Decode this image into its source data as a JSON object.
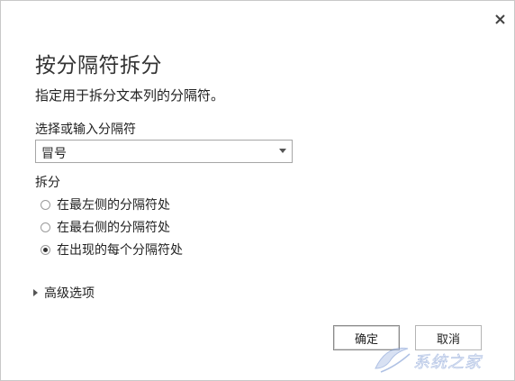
{
  "dialog": {
    "title": "按分隔符拆分",
    "description": "指定用于拆分文本列的分隔符。",
    "close_icon": "close-icon",
    "delimiter": {
      "label": "选择或输入分隔符",
      "value": "冒号"
    },
    "split": {
      "label": "拆分",
      "options": [
        {
          "label": "在最左侧的分隔符处",
          "checked": false
        },
        {
          "label": "在最右侧的分隔符处",
          "checked": false
        },
        {
          "label": "在出现的每个分隔符处",
          "checked": true
        }
      ]
    },
    "advanced": {
      "label": "高级选项"
    },
    "buttons": {
      "ok": "确定",
      "cancel": "取消"
    }
  },
  "watermark": {
    "text": "系统之家"
  }
}
